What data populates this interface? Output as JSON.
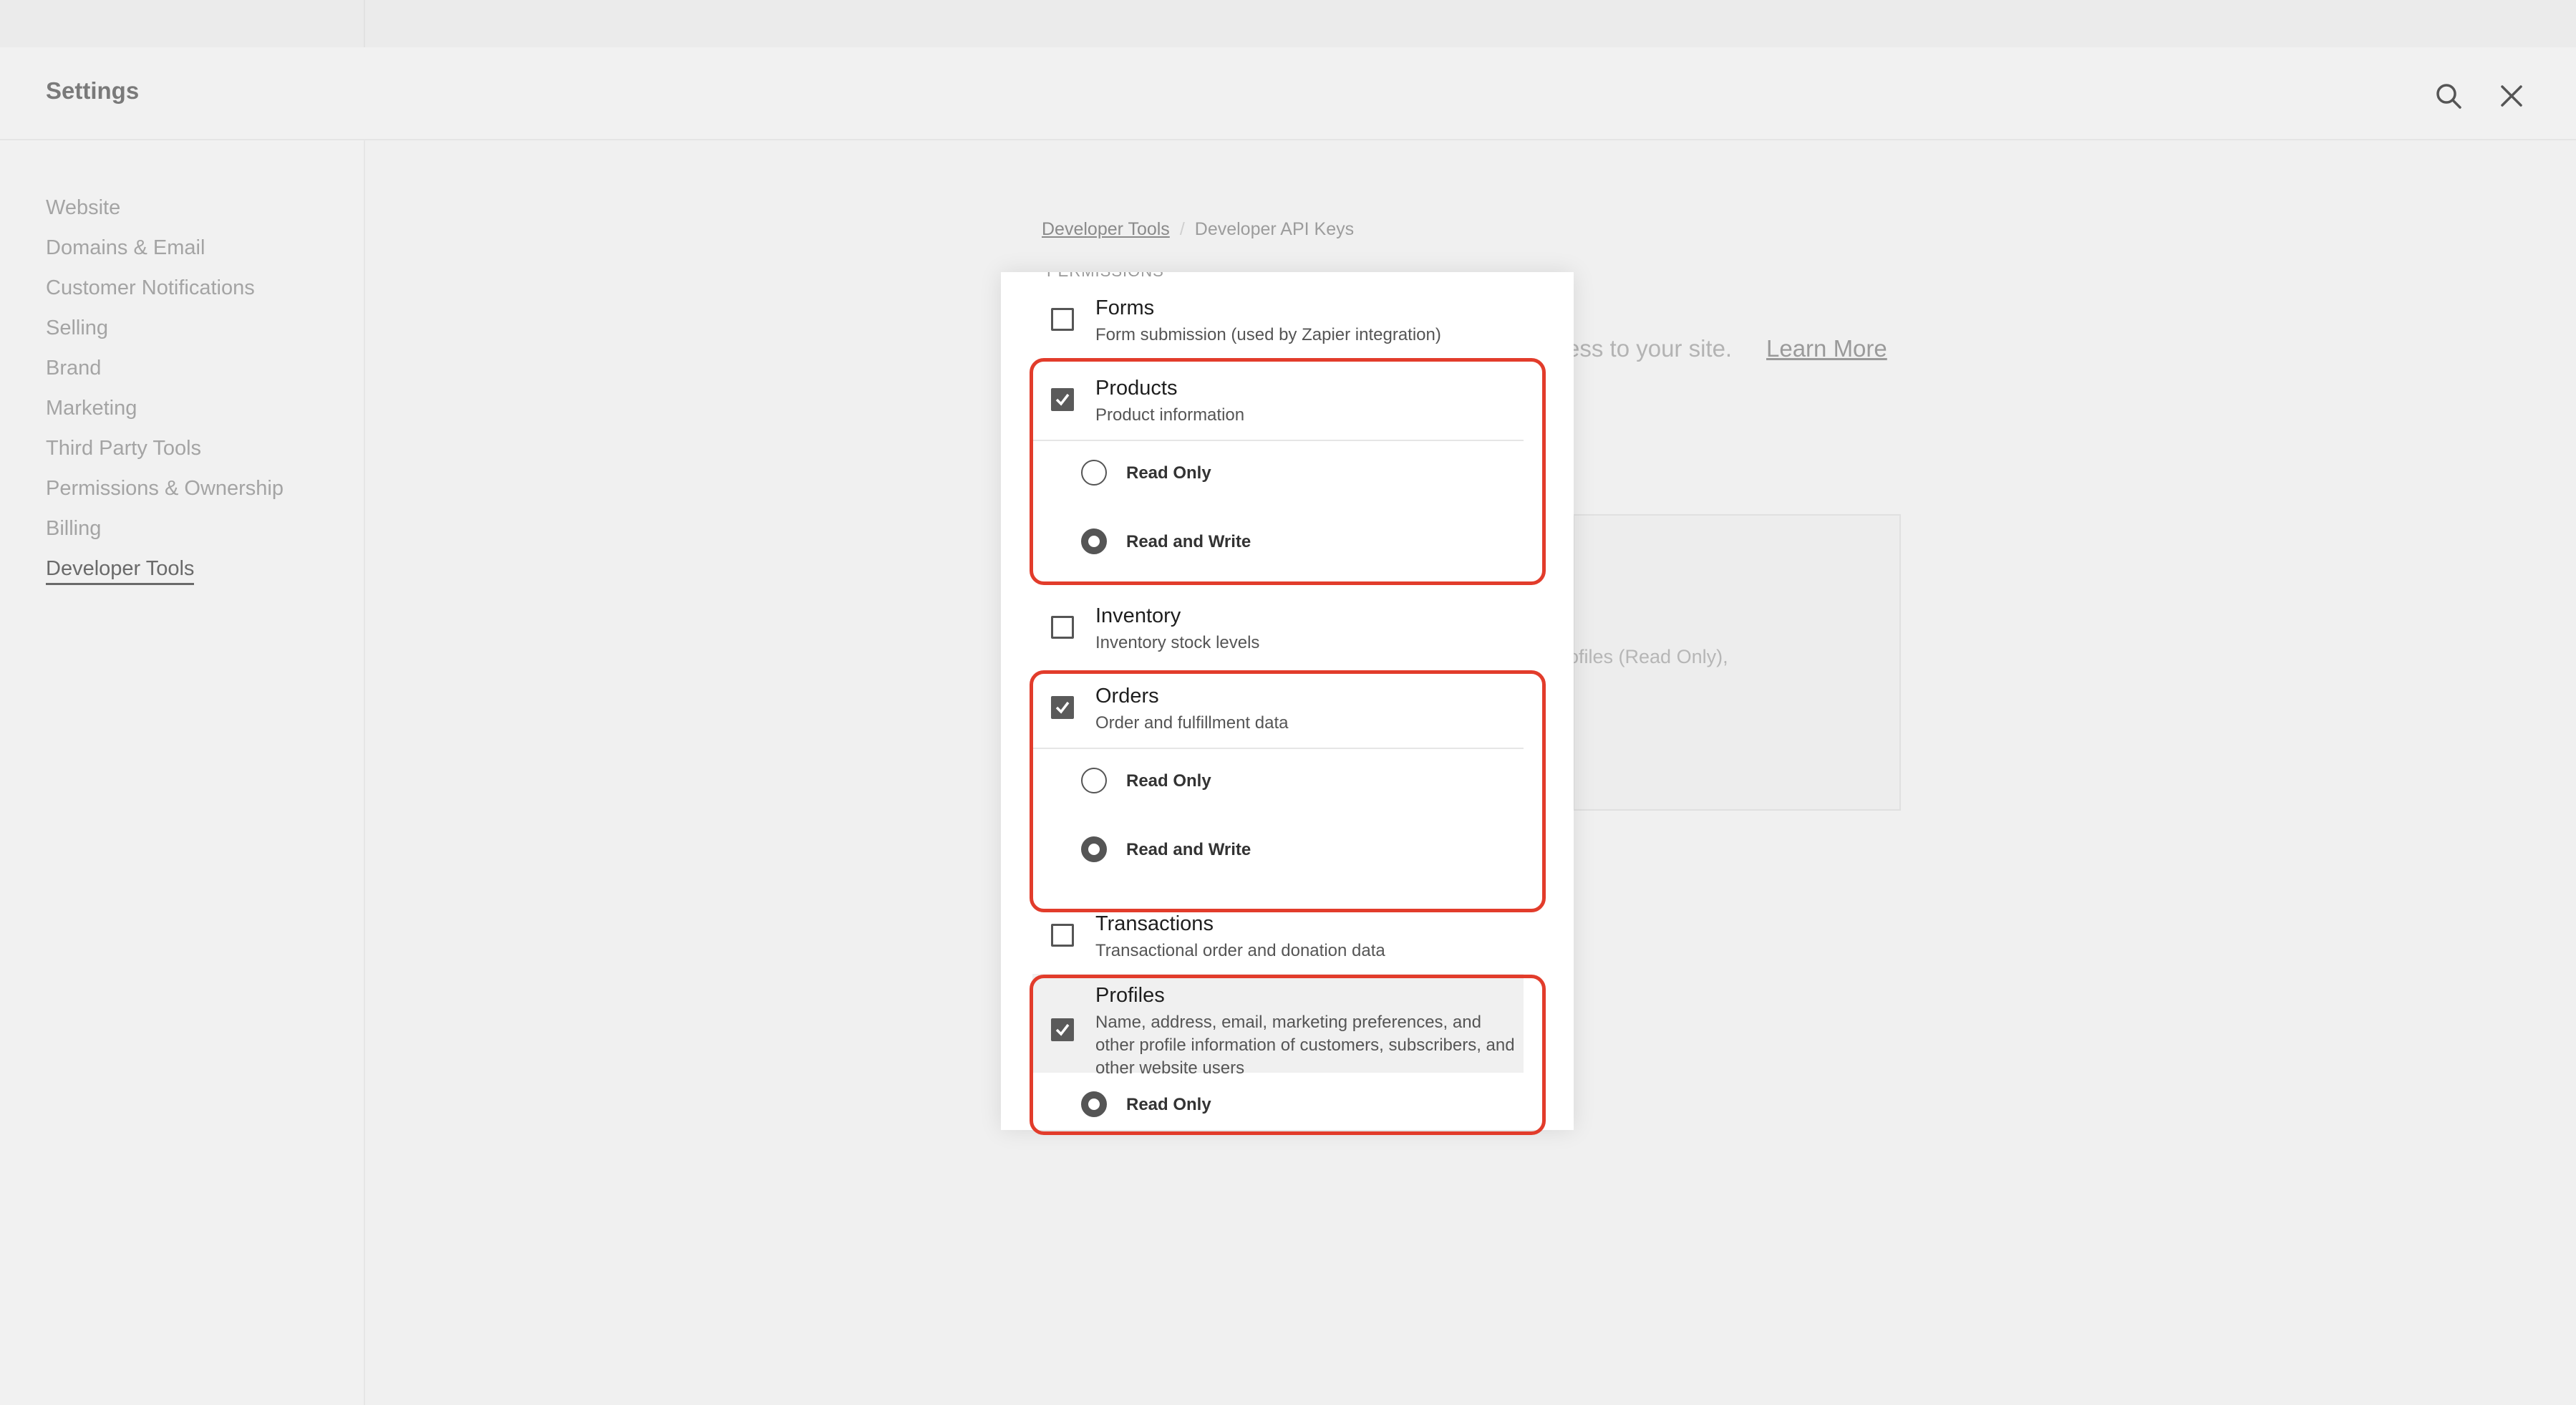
{
  "header": {
    "title": "Settings",
    "search_icon": "search-icon",
    "close_icon": "close-icon"
  },
  "sidebar": {
    "items": [
      {
        "label": "Website",
        "active": false
      },
      {
        "label": "Domains & Email",
        "active": false
      },
      {
        "label": "Customer Notifications",
        "active": false
      },
      {
        "label": "Selling",
        "active": false
      },
      {
        "label": "Brand",
        "active": false
      },
      {
        "label": "Marketing",
        "active": false
      },
      {
        "label": "Third Party Tools",
        "active": false
      },
      {
        "label": "Permissions & Ownership",
        "active": false
      },
      {
        "label": "Billing",
        "active": false
      },
      {
        "label": "Developer Tools",
        "active": true
      }
    ]
  },
  "breadcrumb": {
    "parent": "Developer Tools",
    "separator": "/",
    "current": "Developer API Keys"
  },
  "background": {
    "description_fragment": "ccess to your site.",
    "learn_more": "Learn More",
    "card_fragment": "ofiles (Read Only),"
  },
  "modal": {
    "section_label": "PERMISSIONS",
    "permissions": [
      {
        "title": "Forms",
        "description": "Form submission (used by Zapier integration)",
        "checked": false
      },
      {
        "title": "Products",
        "description": "Product information",
        "checked": true,
        "options": [
          {
            "label": "Read Only",
            "selected": false
          },
          {
            "label": "Read and Write",
            "selected": true
          }
        ]
      },
      {
        "title": "Inventory",
        "description": "Inventory stock levels",
        "checked": false
      },
      {
        "title": "Orders",
        "description": "Order and fulfillment data",
        "checked": true,
        "options": [
          {
            "label": "Read Only",
            "selected": false
          },
          {
            "label": "Read and Write",
            "selected": true
          }
        ]
      },
      {
        "title": "Transactions",
        "description": "Transactional order and donation data",
        "checked": false
      },
      {
        "title": "Profiles",
        "description": "Name, address, email, marketing preferences, and other profile information of customers, subscribers, and other website users",
        "checked": true,
        "options": [
          {
            "label": "Read Only",
            "selected": true
          }
        ]
      }
    ]
  },
  "colors": {
    "highlight": "#e23c2b",
    "checkbox_fill": "#5a5a5a"
  }
}
